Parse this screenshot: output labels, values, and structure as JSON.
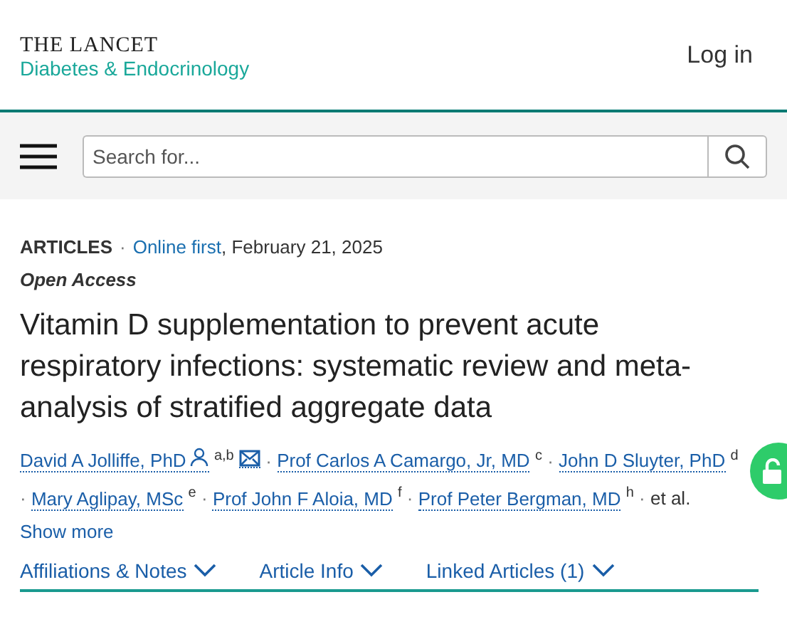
{
  "header": {
    "brand_top": "THE LANCET",
    "brand_bottom": "Diabetes & Endocrinology",
    "login": "Log in"
  },
  "search": {
    "placeholder": "Search for..."
  },
  "article": {
    "type": "ARTICLES",
    "separator": "·",
    "status": "Online first",
    "date": ", February 21, 2025",
    "access": "Open Access",
    "title": "Vitamin D supplementation to prevent acute respiratory infections: systematic review and meta-analysis of stratified aggregate data",
    "authors": [
      {
        "name": "David A Jolliffe, PhD",
        "affiliations": "a,b",
        "corresponding": true
      },
      {
        "name": "Prof Carlos A Camargo, Jr, MD",
        "affiliations": "c",
        "corresponding": false
      },
      {
        "name": "John D Sluyter, PhD",
        "affiliations": "d",
        "corresponding": false
      },
      {
        "name": "Mary Aglipay, MSc",
        "affiliations": "e",
        "corresponding": false
      },
      {
        "name": "Prof John F Aloia, MD",
        "affiliations": "f",
        "corresponding": false
      },
      {
        "name": "Prof Peter Bergman, MD",
        "affiliations": "h",
        "corresponding": false
      }
    ],
    "et_al": "et al.",
    "show_more": "Show more",
    "sections": [
      {
        "label": "Affiliations & Notes",
        "expanded": false
      },
      {
        "label": "Article Info",
        "expanded": false
      },
      {
        "label": "Linked Articles (1)",
        "expanded": false
      }
    ]
  }
}
